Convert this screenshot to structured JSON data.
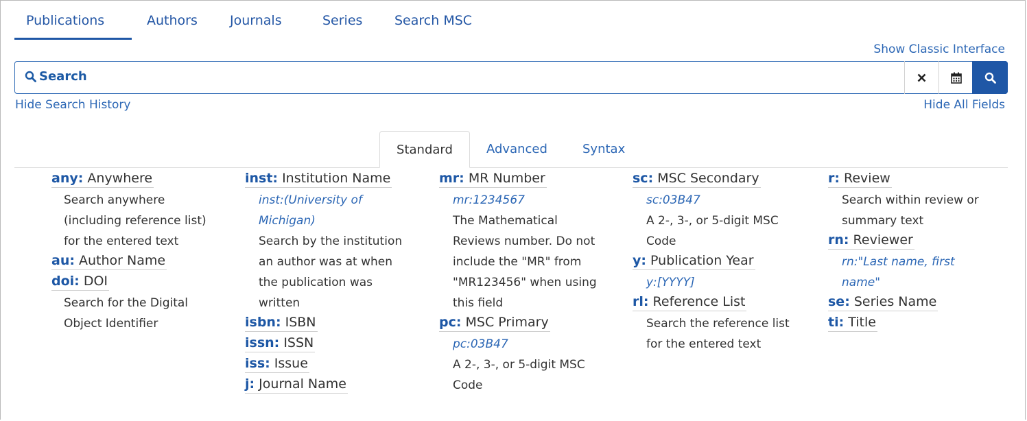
{
  "nav": {
    "tabs": [
      "Publications",
      "Authors",
      "Journals",
      "Series",
      "Search MSC"
    ],
    "active": "Publications"
  },
  "links": {
    "classic": "Show Classic Interface",
    "hide_history": "Hide Search History",
    "hide_fields": "Hide All Fields"
  },
  "search": {
    "label": "Search",
    "icons": [
      "search-icon",
      "close-icon",
      "calendar-icon",
      "search-icon"
    ]
  },
  "field_tabs": {
    "items": [
      "Standard",
      "Advanced",
      "Syntax"
    ],
    "active": "Standard"
  },
  "fields": {
    "any": {
      "key": "any:",
      "name": "Anywhere",
      "desc": [
        "Search anywhere",
        "(including reference list)",
        "for the entered text"
      ]
    },
    "au": {
      "key": "au:",
      "name": "Author Name"
    },
    "doi": {
      "key": "doi:",
      "name": "DOI",
      "desc": [
        "Search for the Digital",
        "Object Identifier"
      ]
    },
    "inst": {
      "key": "inst:",
      "name": "Institution Name",
      "example": [
        "inst:(University of",
        "Michigan)"
      ],
      "desc": [
        "Search by the institution",
        "an author was at when",
        "the publication was",
        "written"
      ]
    },
    "isbn": {
      "key": "isbn:",
      "name": "ISBN"
    },
    "issn": {
      "key": "issn:",
      "name": "ISSN"
    },
    "iss": {
      "key": "iss:",
      "name": "Issue"
    },
    "j": {
      "key": "j:",
      "name": "Journal Name"
    },
    "mr": {
      "key": "mr:",
      "name": "MR Number",
      "example": [
        "mr:1234567"
      ],
      "desc": [
        "The Mathematical",
        "Reviews number. Do not",
        "include the \"MR\" from",
        "\"MR123456\" when using",
        "this field"
      ]
    },
    "pc": {
      "key": "pc:",
      "name": "MSC Primary",
      "example": [
        "pc:03B47"
      ],
      "desc": [
        "A 2-, 3-, or 5-digit MSC",
        "Code"
      ]
    },
    "sc": {
      "key": "sc:",
      "name": "MSC Secondary",
      "example": [
        "sc:03B47"
      ],
      "desc": [
        "A 2-, 3-, or 5-digit MSC",
        "Code"
      ]
    },
    "y": {
      "key": "y:",
      "name": "Publication Year",
      "example": [
        "y:[YYYY]"
      ]
    },
    "rl": {
      "key": "rl:",
      "name": "Reference List",
      "desc": [
        "Search the reference list",
        "for the entered text"
      ]
    },
    "r": {
      "key": "r:",
      "name": "Review",
      "desc": [
        "Search within review or",
        "summary text"
      ]
    },
    "rn": {
      "key": "rn:",
      "name": "Reviewer",
      "example": [
        "rn:\"Last name, first",
        "name\""
      ]
    },
    "se": {
      "key": "se:",
      "name": "Series Name"
    },
    "ti": {
      "key": "ti:",
      "name": "Title"
    }
  },
  "colors": {
    "link": "#2c67b5",
    "accent": "#1f57a6",
    "text": "#333333"
  }
}
